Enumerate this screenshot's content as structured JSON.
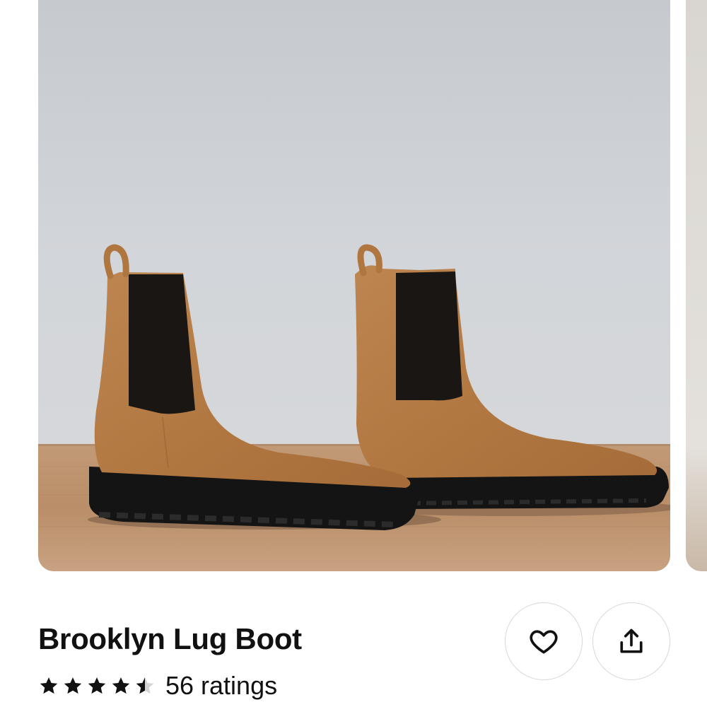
{
  "product": {
    "title": "Brooklyn Lug Boot",
    "rating_value": 4.5,
    "rating_max": 5,
    "ratings_text": "56 ratings",
    "image_alt": "Pair of tan suede Chelsea boots with black elastic panels and black lug soles on a wooden floor"
  },
  "actions": {
    "favorite_icon": "heart-icon",
    "share_icon": "share-icon"
  },
  "colors": {
    "suede": "#b57a45",
    "elastic": "#1a1614",
    "sole": "#141414",
    "floor": "#b88d68",
    "wall": "#d1d4d8"
  }
}
